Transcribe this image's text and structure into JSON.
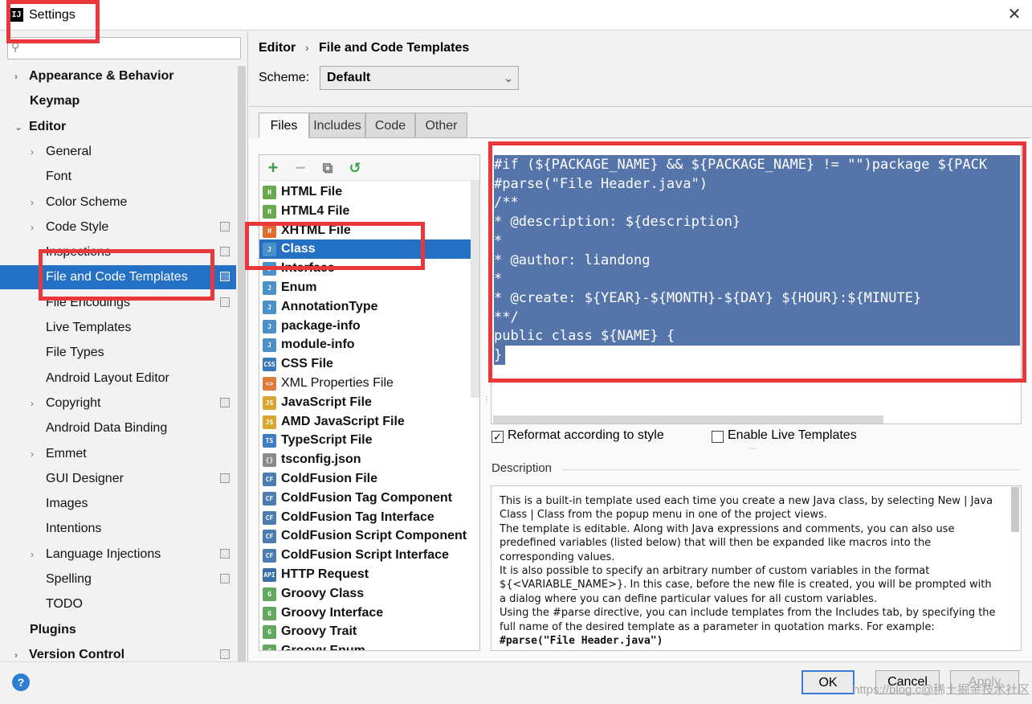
{
  "window": {
    "title": "Settings",
    "close_glyph": "✕",
    "app_icon": "IJ"
  },
  "search": {
    "placeholder": "",
    "icon": "search-icon"
  },
  "sidebar": {
    "items": [
      {
        "label": "Appearance & Behavior",
        "level": 0,
        "arrow": "›",
        "bold": true
      },
      {
        "label": "Keymap",
        "level": 0,
        "bold": true
      },
      {
        "label": "Editor",
        "level": 0,
        "arrow": "⌄",
        "bold": true
      },
      {
        "label": "General",
        "level": 1,
        "arrow": "›"
      },
      {
        "label": "Font",
        "level": 1
      },
      {
        "label": "Color Scheme",
        "level": 1,
        "arrow": "›"
      },
      {
        "label": "Code Style",
        "level": 1,
        "arrow": "›",
        "proj": true
      },
      {
        "label": "Inspections",
        "level": 1,
        "proj": true
      },
      {
        "label": "File and Code Templates",
        "level": 1,
        "proj": true,
        "selected": true
      },
      {
        "label": "File Encodings",
        "level": 1,
        "proj": true
      },
      {
        "label": "Live Templates",
        "level": 1
      },
      {
        "label": "File Types",
        "level": 1
      },
      {
        "label": "Android Layout Editor",
        "level": 1
      },
      {
        "label": "Copyright",
        "level": 1,
        "arrow": "›",
        "proj": true
      },
      {
        "label": "Android Data Binding",
        "level": 1
      },
      {
        "label": "Emmet",
        "level": 1,
        "arrow": "›"
      },
      {
        "label": "GUI Designer",
        "level": 1,
        "proj": true
      },
      {
        "label": "Images",
        "level": 1
      },
      {
        "label": "Intentions",
        "level": 1
      },
      {
        "label": "Language Injections",
        "level": 1,
        "arrow": "›",
        "proj": true
      },
      {
        "label": "Spelling",
        "level": 1,
        "proj": true
      },
      {
        "label": "TODO",
        "level": 1
      },
      {
        "label": "Plugins",
        "level": 0,
        "bold": true
      },
      {
        "label": "Version Control",
        "level": 0,
        "arrow": "›",
        "bold": true,
        "proj": true
      }
    ]
  },
  "header": {
    "breadcrumb": [
      "Editor",
      "File and Code Templates"
    ],
    "breadcrumb_sep": "›",
    "scheme_label": "Scheme:",
    "scheme_value": "Default",
    "scheme_chevron": "⌄"
  },
  "tabs": [
    {
      "label": "Files",
      "active": true
    },
    {
      "label": "Includes"
    },
    {
      "label": "Code"
    },
    {
      "label": "Other"
    }
  ],
  "toolbar": {
    "add": "+",
    "remove": "−",
    "copy": "⧉",
    "reset": "↺"
  },
  "templates": [
    {
      "label": "HTML File",
      "icon": "html-file-icon",
      "badge": "H",
      "color": "#6aa84f"
    },
    {
      "label": "HTML4 File",
      "icon": "html-file-icon",
      "badge": "H",
      "color": "#6aa84f"
    },
    {
      "label": "XHTML File",
      "icon": "xhtml-file-icon",
      "badge": "H",
      "color": "#e06c2e"
    },
    {
      "label": "Class",
      "icon": "java-class-icon",
      "badge": "J",
      "color": "#4a90c9",
      "selected": true
    },
    {
      "label": "Interface",
      "icon": "java-interface-icon",
      "badge": "J",
      "color": "#4a90c9"
    },
    {
      "label": "Enum",
      "icon": "java-enum-icon",
      "badge": "J",
      "color": "#4a90c9"
    },
    {
      "label": "AnnotationType",
      "icon": "java-annotation-icon",
      "badge": "J",
      "color": "#4a90c9"
    },
    {
      "label": "package-info",
      "icon": "java-file-icon",
      "badge": "J",
      "color": "#4a90c9"
    },
    {
      "label": "module-info",
      "icon": "java-file-icon",
      "badge": "J",
      "color": "#4a90c9"
    },
    {
      "label": "CSS File",
      "icon": "css-file-icon",
      "badge": "CSS",
      "color": "#3a7bbf"
    },
    {
      "label": "XML Properties File",
      "icon": "xml-file-icon",
      "badge": "<>",
      "color": "#e07b39",
      "normal": true
    },
    {
      "label": "JavaScript File",
      "icon": "js-file-icon",
      "badge": "JS",
      "color": "#d8a530"
    },
    {
      "label": "AMD JavaScript File",
      "icon": "js-file-icon",
      "badge": "JS",
      "color": "#d8a530"
    },
    {
      "label": "TypeScript File",
      "icon": "ts-file-icon",
      "badge": "TS",
      "color": "#3f7ec6"
    },
    {
      "label": "tsconfig.json",
      "icon": "json-file-icon",
      "badge": "{}",
      "color": "#8a8a8a"
    },
    {
      "label": "ColdFusion File",
      "icon": "coldfusion-icon",
      "badge": "CF",
      "color": "#4b7db2"
    },
    {
      "label": "ColdFusion Tag Component",
      "icon": "coldfusion-icon",
      "badge": "CF",
      "color": "#4b7db2"
    },
    {
      "label": "ColdFusion Tag Interface",
      "icon": "coldfusion-icon",
      "badge": "CF",
      "color": "#4b7db2"
    },
    {
      "label": "ColdFusion Script Component",
      "icon": "coldfusion-icon",
      "badge": "CF",
      "color": "#4b7db2"
    },
    {
      "label": "ColdFusion Script Interface",
      "icon": "coldfusion-icon",
      "badge": "CF",
      "color": "#4b7db2"
    },
    {
      "label": "HTTP Request",
      "icon": "http-request-icon",
      "badge": "API",
      "color": "#3a6ea5"
    },
    {
      "label": "Groovy Class",
      "icon": "groovy-icon",
      "badge": "G",
      "color": "#62a85e"
    },
    {
      "label": "Groovy Interface",
      "icon": "groovy-icon",
      "badge": "G",
      "color": "#62a85e"
    },
    {
      "label": "Groovy Trait",
      "icon": "groovy-icon",
      "badge": "G",
      "color": "#62a85e"
    },
    {
      "label": "Groovy Enum",
      "icon": "groovy-icon",
      "badge": "G",
      "color": "#62a85e"
    }
  ],
  "editor": {
    "lines": [
      "#if (${PACKAGE_NAME} && ${PACKAGE_NAME} != \"\")package ${PACK",
      "#parse(\"File Header.java\")",
      "/**",
      "* @description: ${description}",
      "*",
      "* @author: liandong",
      "*",
      "* @create: ${YEAR}-${MONTH}-${DAY} ${HOUR}:${MINUTE}",
      "**/",
      "public class ${NAME} {",
      "}"
    ],
    "selection_color": "#5574a9"
  },
  "options": {
    "reformat_label": "Reformat according to style",
    "reformat_checked": true,
    "live_label": "Enable Live Templates",
    "live_checked": false
  },
  "description": {
    "title": "Description",
    "paragraphs": [
      "This is a built-in template used each time you create a new Java class, by selecting New | Java Class | Class from the popup menu in one of the project views.",
      "The template is editable. Along with Java expressions and comments, you can also use predefined variables (listed below) that will then be expanded like macros into the corresponding values.",
      "It is also possible to specify an arbitrary number of custom variables in the format ${<VARIABLE_NAME>}. In this case, before the new file is created, you will be prompted with a dialog where you can define particular values for all custom variables.",
      "Using the #parse directive, you can include templates from the Includes tab, by specifying the full name of the desired template as a parameter in quotation marks. For example:",
      "#parse(\"File Header.java\")"
    ]
  },
  "footer": {
    "help": "?",
    "ok": "OK",
    "cancel": "Cancel",
    "apply": "Apply",
    "watermark": "https://blog.c@稀土掘金技术社区"
  },
  "colors": {
    "accent": "#2470c4",
    "highlight_box": "#e8383c",
    "selection": "#5574a9"
  }
}
